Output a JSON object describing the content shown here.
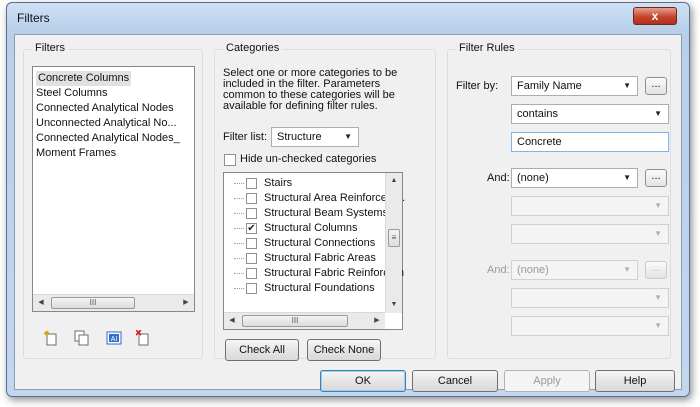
{
  "window": {
    "title": "Filters",
    "close_glyph": "x"
  },
  "filters": {
    "group_title": "Filters",
    "items": [
      "Concrete Columns",
      "Steel Columns",
      "Connected Analytical Nodes",
      "Unconnected Analytical No...",
      "Connected Analytical Nodes_",
      "Moment Frames"
    ],
    "selected_index": 0,
    "scroll_thumb_glyph": "III",
    "toolbar_icons": [
      "new-filter-icon",
      "duplicate-filter-icon",
      "rename-filter-icon",
      "delete-filter-icon"
    ]
  },
  "categories": {
    "group_title": "Categories",
    "description": "Select one or more categories to be included in the filter.  Parameters common to these categories will be available for defining filter rules.",
    "filter_list_label": "Filter list:",
    "filter_list_value": "Structure",
    "hide_unchecked_label": "Hide un-checked categories",
    "hide_unchecked": false,
    "items": [
      {
        "label": "Stairs",
        "checked": false
      },
      {
        "label": "Structural Area Reinforcem...",
        "checked": false
      },
      {
        "label": "Structural Beam Systems",
        "checked": false
      },
      {
        "label": "Structural Columns",
        "checked": true
      },
      {
        "label": "Structural Connections",
        "checked": false
      },
      {
        "label": "Structural Fabric Areas",
        "checked": false
      },
      {
        "label": "Structural Fabric Reinforcem",
        "checked": false
      },
      {
        "label": "Structural Foundations",
        "checked": false
      }
    ],
    "scroll_thumb_glyph": "III",
    "check_all_label": "Check All",
    "check_none_label": "Check None"
  },
  "rules": {
    "group_title": "Filter Rules",
    "filter_by_label": "Filter by:",
    "filter_by_value": "Family Name",
    "operator_value": "contains",
    "value_text": "Concrete",
    "and1_label": "And:",
    "and1_value": "(none)",
    "and2_label": "And:",
    "and2_value": "(none)",
    "dots_label": "..."
  },
  "footer": {
    "ok_label": "OK",
    "cancel_label": "Cancel",
    "apply_label": "Apply",
    "help_label": "Help"
  },
  "colors": {
    "titlebar": "#b8cfe9",
    "client_bg": "#f0f0f0",
    "close_red": "#c5432c",
    "focus_blue": "#3c7fb1"
  }
}
